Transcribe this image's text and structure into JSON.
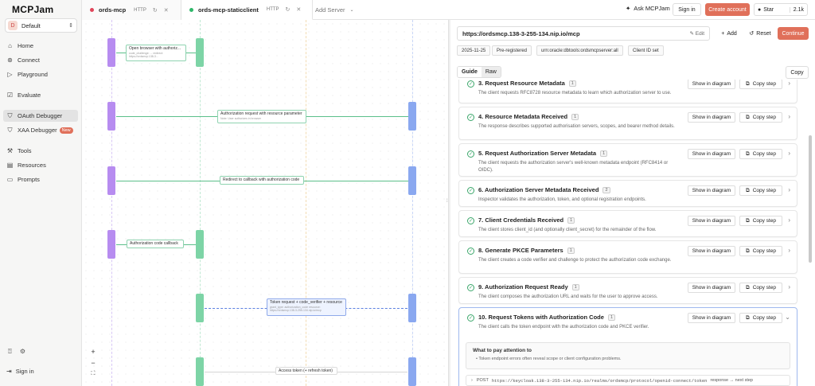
{
  "sidebar": {
    "logo": "MCPJam",
    "workspace": {
      "avatar": "D",
      "name": "Default"
    },
    "items": [
      {
        "label": "Home",
        "icon": "home-icon",
        "glyph": "⌂"
      },
      {
        "label": "Connect",
        "icon": "plug-icon",
        "glyph": "⊛"
      },
      {
        "label": "Playground",
        "icon": "play-icon",
        "glyph": "▷"
      },
      {
        "label": "Evaluate",
        "icon": "check-square-icon",
        "glyph": "☑"
      },
      {
        "label": "OAuth Debugger",
        "icon": "shield-icon",
        "glyph": "⛉"
      },
      {
        "label": "XAA Debugger",
        "icon": "shield-check-icon",
        "glyph": "⛉",
        "badge": "New"
      },
      {
        "label": "Tools",
        "icon": "wrench-icon",
        "glyph": "⚒"
      },
      {
        "label": "Resources",
        "icon": "book-icon",
        "glyph": "▤"
      },
      {
        "label": "Prompts",
        "icon": "message-icon",
        "glyph": "▭"
      }
    ],
    "sign_in": "Sign in"
  },
  "topbar": {
    "tabs": [
      {
        "name": "ords-mcp",
        "protocol": "HTTP",
        "status_color": "#e0455a"
      },
      {
        "name": "ords-mcp-staticclient",
        "protocol": "HTTP",
        "status_color": "#2fb86a"
      }
    ],
    "add_server": "Add Server",
    "ask": "Ask MCPJam",
    "sign_in": "Sign in",
    "create_account": "Create account",
    "star": "Star",
    "star_count": "2.1k"
  },
  "diagram": {
    "messages": [
      {
        "label": "Open browser with authoriz...",
        "sub": "code_challenge: ...\nredirect: https://ordsmcp.138-3..."
      },
      {
        "label": "Authorization request with resource parameter",
        "sub": "Note: User authorizes in browser"
      },
      {
        "label": "Redirect to callback with authorization code",
        "sub": ""
      },
      {
        "label": "Authorization code callback",
        "sub": ""
      },
      {
        "label": "Token request + code_verifier + resource",
        "sub": "grant_type: authorization_code\nresource: https://ordsmcp.138-3-255-134.nip.io/mcp"
      },
      {
        "label": "Access token (+ refresh token)",
        "sub": ""
      }
    ],
    "zoom_in": "+",
    "zoom_out": "−",
    "fit": "⛶"
  },
  "panel": {
    "url": "https://ordsmcp.138-3-255-134.nip.io/mcp",
    "edit": "Edit",
    "add": "Add",
    "reset": "Reset",
    "continue": "Continue",
    "chips": [
      "2025-11-25",
      "Pre-registered",
      "urn:oracle:dbtools:ordsmcpserver:all",
      "Client ID set"
    ],
    "view_modes": [
      "Guide",
      "Raw"
    ],
    "copy": "Copy",
    "show_in_diagram": "Show in diagram",
    "copy_step": "Copy step",
    "steps": [
      {
        "title": "3. Request Resource Metadata",
        "count": "1",
        "desc": "The client requests RFC8728 resource metadata to learn which authorization server to use."
      },
      {
        "title": "4. Resource Metadata Received",
        "count": "1",
        "desc": "The response describes supported authorisation servers, scopes, and bearer method details."
      },
      {
        "title": "5. Request Authorization Server Metadata",
        "count": "1",
        "desc": "The client requests the authorization server's well-known metadata endpoint (RFC8414 or OIDC)."
      },
      {
        "title": "6. Authorization Server Metadata Received",
        "count": "2",
        "desc": "Inspector validates the authorization, token, and optional registration endpoints."
      },
      {
        "title": "7. Client Credentials Received",
        "count": "1",
        "desc": "The client stores client_id (and optionally client_secret) for the remainder of the flow."
      },
      {
        "title": "8. Generate PKCE Parameters",
        "count": "1",
        "desc": "The client creates a code verifier and challenge to protect the authorization code exchange."
      },
      {
        "title": "9. Authorization Request Ready",
        "count": "1",
        "desc": "The client composes the authorization URL and waits for the user to approve access."
      },
      {
        "title": "10. Request Tokens with Authorization Code",
        "count": "1",
        "desc": "The client calls the token endpoint with the authorization code and PKCE verifier."
      }
    ],
    "attention_title": "What to pay attention to",
    "attention_item": "Token endpoint errors often reveal scope or client configuration problems.",
    "request_method": "POST",
    "request_url": "https://keycloak.138-3-255-134.nip.io/realms/ordsmcp/protocol/openid-connect/token",
    "request_note": "response → next step"
  },
  "colors": {
    "accent": "#e0705a",
    "green": "#2fb86a",
    "lifeline_purple": "#b78cf0",
    "lifeline_green": "#7dd4a6",
    "lifeline_blue": "#8aa8f0"
  }
}
